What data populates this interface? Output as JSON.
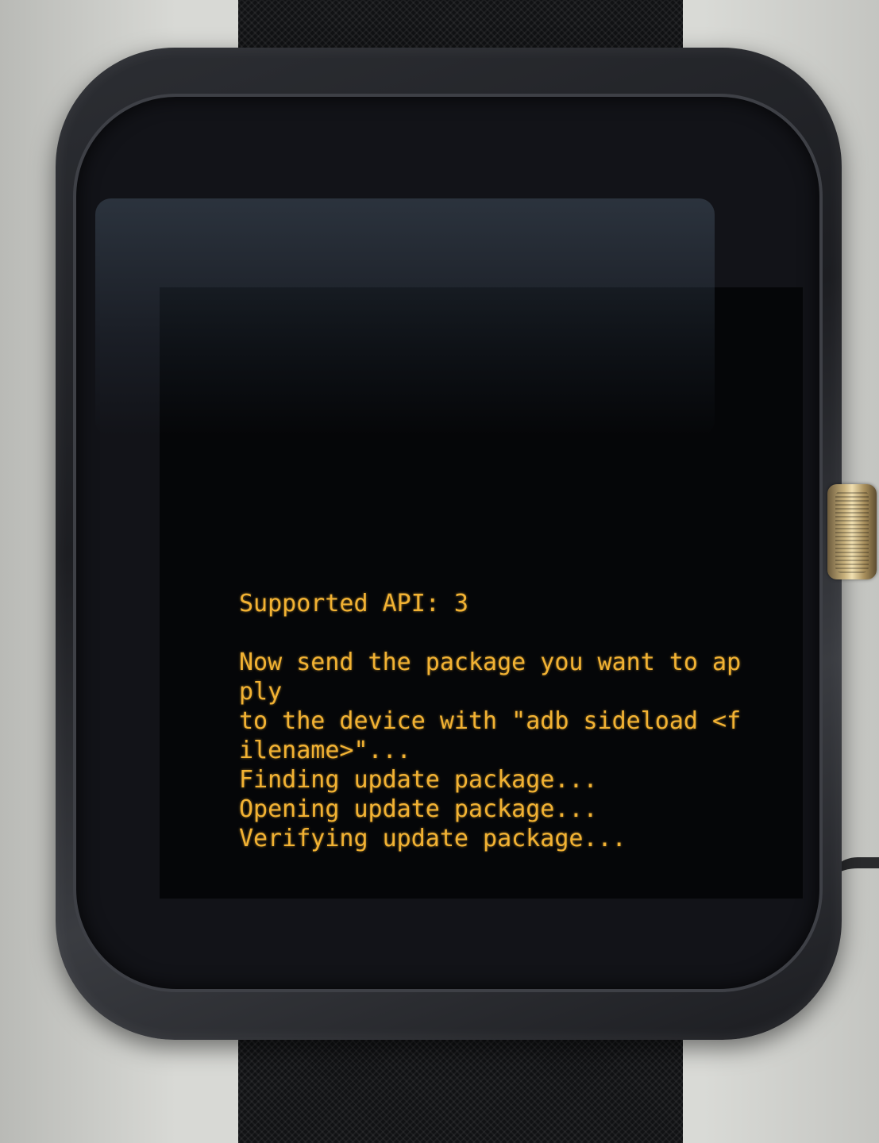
{
  "device": {
    "type": "smartwatch",
    "crown_icon": "crown-button",
    "colors": {
      "terminal_text": "#f2b233",
      "screen_background": "#050608",
      "strap": "#111214",
      "case": "#2c2e33"
    }
  },
  "recovery": {
    "lines": [
      "Supported API: 3",
      "",
      "Now send the package you want to ap",
      "ply",
      "to the device with \"adb sideload <f",
      "ilename>\"...",
      "Finding update package...",
      "Opening update package...",
      "Verifying update package..."
    ]
  }
}
